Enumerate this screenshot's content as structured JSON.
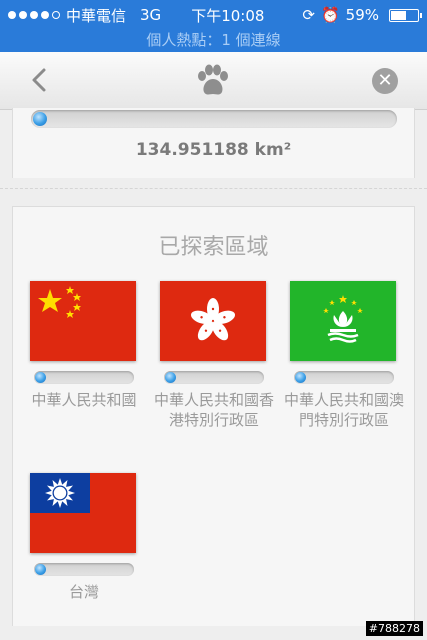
{
  "status_bar": {
    "carrier": "中華電信",
    "network": "3G",
    "time": "下午10:08",
    "battery": "59%",
    "battery_level": 0.59
  },
  "hotspot_banner": "個人熱點：1 個連線",
  "nav": {
    "back_icon": "chevron-left-icon",
    "logo_icon": "paw-icon",
    "close_icon": "close-icon"
  },
  "area": {
    "value": "134.951188 km²",
    "progress": 0.02
  },
  "explored": {
    "title": "已探索區域",
    "regions": [
      {
        "name": "中華人民共和國",
        "flag": "china-flag",
        "progress": 0.02
      },
      {
        "name": "中華人民共和國香港特別行政區",
        "flag": "hong-kong-flag",
        "progress": 0.02
      },
      {
        "name": "中華人民共和國澳門特別行政區",
        "flag": "macau-flag",
        "progress": 0.02
      },
      {
        "name": "台灣",
        "flag": "taiwan-flag",
        "progress": 0.02
      }
    ]
  },
  "watermark": "#788278",
  "colors": {
    "status_blue": "#2a7bd9",
    "china_red": "#de2910",
    "hk_red": "#de2910",
    "macau_green": "#00a651",
    "taiwan_blue": "#0d3ea0"
  }
}
